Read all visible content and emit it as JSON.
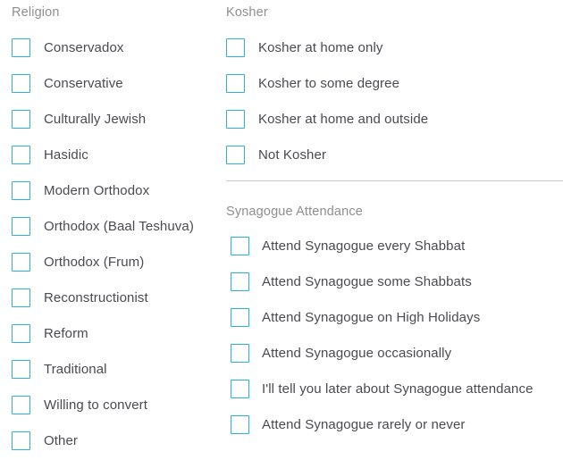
{
  "columns": {
    "left": {
      "religion": {
        "title": "Religion",
        "options": [
          {
            "label": "Conservadox",
            "checked": false
          },
          {
            "label": "Conservative",
            "checked": false
          },
          {
            "label": "Culturally Jewish",
            "checked": false
          },
          {
            "label": "Hasidic",
            "checked": false
          },
          {
            "label": "Modern Orthodox",
            "checked": false
          },
          {
            "label": "Orthodox (Baal Teshuva)",
            "checked": false
          },
          {
            "label": "Orthodox (Frum)",
            "checked": false
          },
          {
            "label": "Reconstructionist",
            "checked": false
          },
          {
            "label": "Reform",
            "checked": false
          },
          {
            "label": "Traditional",
            "checked": false
          },
          {
            "label": "Willing to convert",
            "checked": false
          },
          {
            "label": "Other",
            "checked": false
          }
        ]
      }
    },
    "right": {
      "kosher": {
        "title": "Kosher",
        "options": [
          {
            "label": "Kosher at home only",
            "checked": false
          },
          {
            "label": "Kosher to some degree",
            "checked": false
          },
          {
            "label": "Kosher at home and outside",
            "checked": false
          },
          {
            "label": "Not Kosher",
            "checked": false
          }
        ]
      },
      "synagogue": {
        "title": "Synagogue Attendance",
        "options": [
          {
            "label": "Attend Synagogue every Shabbat",
            "checked": false
          },
          {
            "label": "Attend Synagogue some Shabbats",
            "checked": false
          },
          {
            "label": "Attend Synagogue on High Holidays",
            "checked": false
          },
          {
            "label": "Attend Synagogue occasionally",
            "checked": false
          },
          {
            "label": "I'll tell you later about Synagogue attendance",
            "checked": false
          },
          {
            "label": "Attend Synagogue rarely or never",
            "checked": false
          }
        ]
      }
    }
  },
  "colors": {
    "checkbox_border": "#2bb0e8",
    "group_title": "#8c8f91",
    "option_label": "#4a4a52",
    "divider": "#cccccc",
    "background": "#ffffff"
  }
}
